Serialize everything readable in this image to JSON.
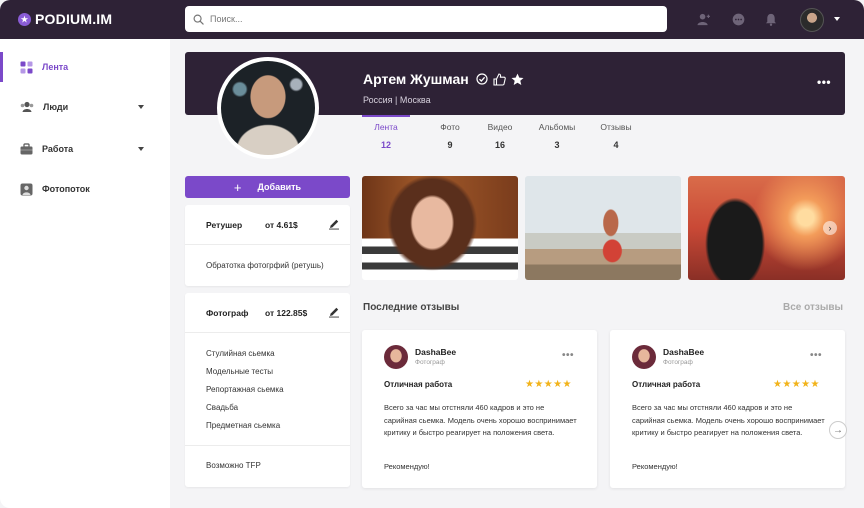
{
  "app": {
    "logo_text": "PODIUM.IM"
  },
  "search": {
    "placeholder": "Поиск..."
  },
  "sidebar": {
    "items": [
      {
        "label": "Лента",
        "icon": "grid-icon"
      },
      {
        "label": "Люди",
        "icon": "people-icon"
      },
      {
        "label": "Работа",
        "icon": "briefcase-icon"
      },
      {
        "label": "Фотопоток",
        "icon": "photo-user-icon"
      }
    ]
  },
  "profile": {
    "name": "Артем Жушман",
    "location": "Россия | Москва",
    "more": "•••"
  },
  "tabs": [
    {
      "label": "Лента",
      "count": "12"
    },
    {
      "label": "Фото",
      "count": "9"
    },
    {
      "label": "Видео",
      "count": "16"
    },
    {
      "label": "Альбомы",
      "count": "3"
    },
    {
      "label": "Отзывы",
      "count": "4"
    }
  ],
  "add_button": {
    "label": "Добавить",
    "plus": "+"
  },
  "services": [
    {
      "title": "Ретушер",
      "price": "от 4.61$",
      "lines": [
        "Обратотка фотогрфий (ретушь)"
      ]
    },
    {
      "title": "Фотограф",
      "price": "от 122.85$",
      "lines": [
        "Стулийная сьемка",
        "Модельные тесты",
        "Репортажная сьемка",
        "Свадьба",
        "Предметная сьемка"
      ],
      "footer": "Возможно TFP"
    }
  ],
  "reviews": {
    "title": "Последние отзывы",
    "all_link": "Все отзывы",
    "items": [
      {
        "name": "DashaBee",
        "role": "Фотограф",
        "title": "Отличная работа",
        "stars": "★★★★★",
        "text": "Всего за час мы отстняли 460 кадров и это не сарийная сьемка. Модель очень хорошо воспринимает критику и быстро реагирует на положения света.",
        "footer": "Рекомендую!",
        "more": "•••"
      },
      {
        "name": "DashaBee",
        "role": "Фотограф",
        "title": "Отличная работа",
        "stars": "★★★★★",
        "text": "Всего за час мы отстняли 460 кадров и это не сарийная сьемка. Модель очень хорошо воспринимает критику и быстро реагирует на положения света.",
        "footer": "Рекомендую!",
        "more": "•••"
      }
    ]
  },
  "colors": {
    "accent": "#7b49c9",
    "header_bg": "#2e2236",
    "star": "#f2b31a"
  }
}
